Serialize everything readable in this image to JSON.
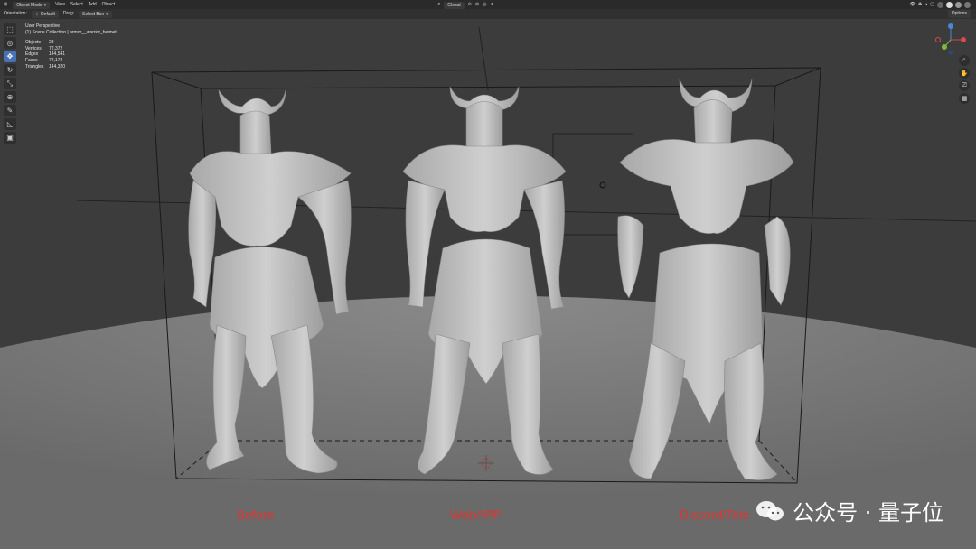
{
  "header": {
    "mode": "Object Mode",
    "menus": [
      "View",
      "Select",
      "Add",
      "Object"
    ],
    "transform_orientation": "Global"
  },
  "tool_header": {
    "orientation_label": "Orientation:",
    "orientation_value": "Default",
    "drag_label": "Drag:",
    "drag_value": "Select Box"
  },
  "options_label": "Options",
  "viewport": {
    "perspective": "User Perspective",
    "collection": "(1) Scene Collection | armor__warrior_helmet",
    "stats": [
      {
        "key": "Objects",
        "value": "23"
      },
      {
        "key": "Vertices",
        "value": "72,372"
      },
      {
        "key": "Edges",
        "value": "144,541"
      },
      {
        "key": "Faces",
        "value": "72,172"
      },
      {
        "key": "Triangles",
        "value": "144,320"
      }
    ]
  },
  "labels": {
    "left": "Before",
    "middle": "WebAPP",
    "right": "Discord/Tele"
  },
  "watermark": {
    "text": "公众号 · 量子位"
  },
  "colors": {
    "label_red": "#e2342e",
    "active_tool": "#4772b3",
    "axis_x": "#d94a4a",
    "axis_y": "#7cba3c",
    "axis_z": "#4a86d9"
  }
}
